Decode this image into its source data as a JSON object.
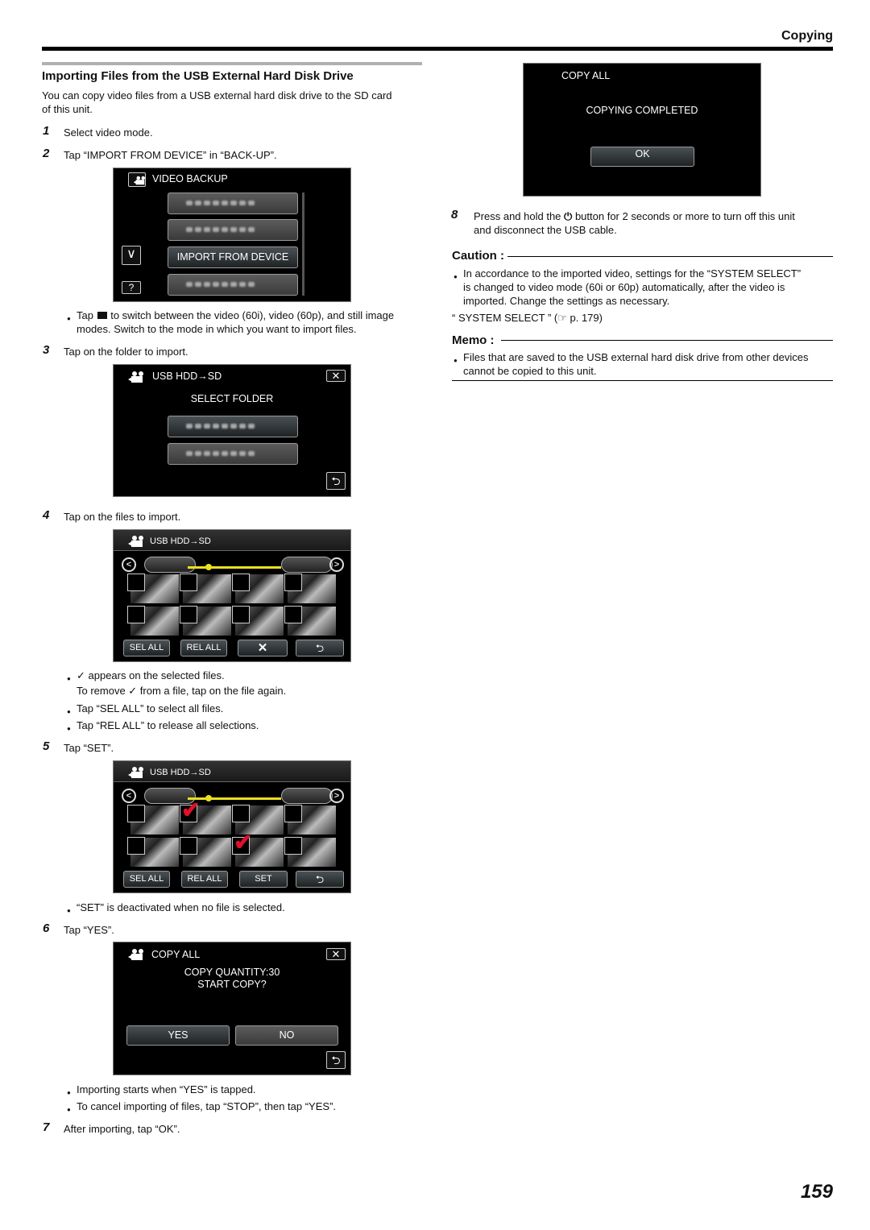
{
  "header": {
    "section": "Copying",
    "page_number": "159"
  },
  "title": "Importing Files from the USB External Hard Disk Drive",
  "intro": [
    "You can copy video files from a USB external hard disk drive to the SD card",
    "of this unit."
  ],
  "steps": {
    "s1": {
      "num": "1",
      "text": "Select video mode."
    },
    "s2": {
      "num": "2",
      "text": "Tap “IMPORT FROM DEVICE” in “BACK-UP”."
    },
    "s2_note": [
      "Tap",
      "to switch between the video (60i), video (60p), and still image",
      "modes. Switch to the mode in which you want to import files."
    ],
    "s3": {
      "num": "3",
      "text": "Tap on the folder to import."
    },
    "s4": {
      "num": "4",
      "text": "Tap on the files to import."
    },
    "s4_notes": [
      "✓ appears on the selected files.",
      "To remove ✓ from a file, tap on the file again.",
      "Tap “SEL ALL” to select all files.",
      "Tap “REL ALL” to release all selections."
    ],
    "s5": {
      "num": "5",
      "text": "Tap “SET”."
    },
    "s5_note": "“SET” is deactivated when no file is selected.",
    "s6": {
      "num": "6",
      "text": "Tap “YES”."
    },
    "s6_notes": [
      "Importing starts when “YES” is tapped.",
      "To cancel importing of files, tap “STOP”, then tap “YES”."
    ],
    "s7": {
      "num": "7",
      "text": "After importing, tap “OK”."
    },
    "s8": {
      "num": "8",
      "text_a": "Press and hold the",
      "text_b": "button for 2 seconds or more to turn off this unit",
      "text_c": "and disconnect the USB cable."
    }
  },
  "screens": {
    "backup": {
      "title": "VIDEO BACKUP",
      "items": [
        "",
        "",
        "IMPORT FROM DEVICE",
        ""
      ],
      "down_icon": "chevron-down",
      "help": "?"
    },
    "folder": {
      "title": "USB HDD→SD",
      "subtitle": "SELECT FOLDER",
      "close": "close",
      "back": "back"
    },
    "files1": {
      "title": "USB HDD→SD",
      "buttons": [
        "SEL ALL",
        "REL ALL",
        "✕",
        "back"
      ],
      "selected": []
    },
    "files2": {
      "title": "USB HDD→SD",
      "buttons": [
        "SEL ALL",
        "REL ALL",
        "SET",
        "back"
      ],
      "selected": [
        1,
        6
      ]
    },
    "confirm": {
      "title": "COPY ALL",
      "line1": "COPY QUANTITY:30",
      "line2": "START COPY?",
      "yes": "YES",
      "no": "NO"
    },
    "done": {
      "title": "COPY ALL",
      "message": "COPYING COMPLETED",
      "ok": "OK"
    }
  },
  "caution": {
    "label": "Caution :",
    "lines": [
      "In accordance to the imported video, settings for the “SYSTEM SELECT”",
      "is changed to video mode (60i or 60p) automatically, after the video is",
      "imported. Change the settings as necessary."
    ],
    "ref": "“ SYSTEM SELECT ” (☞ p. 179)"
  },
  "memo": {
    "label": "Memo :",
    "lines": [
      "Files that are saved to the USB external hard disk drive from other devices",
      "cannot be copied to this unit."
    ]
  }
}
